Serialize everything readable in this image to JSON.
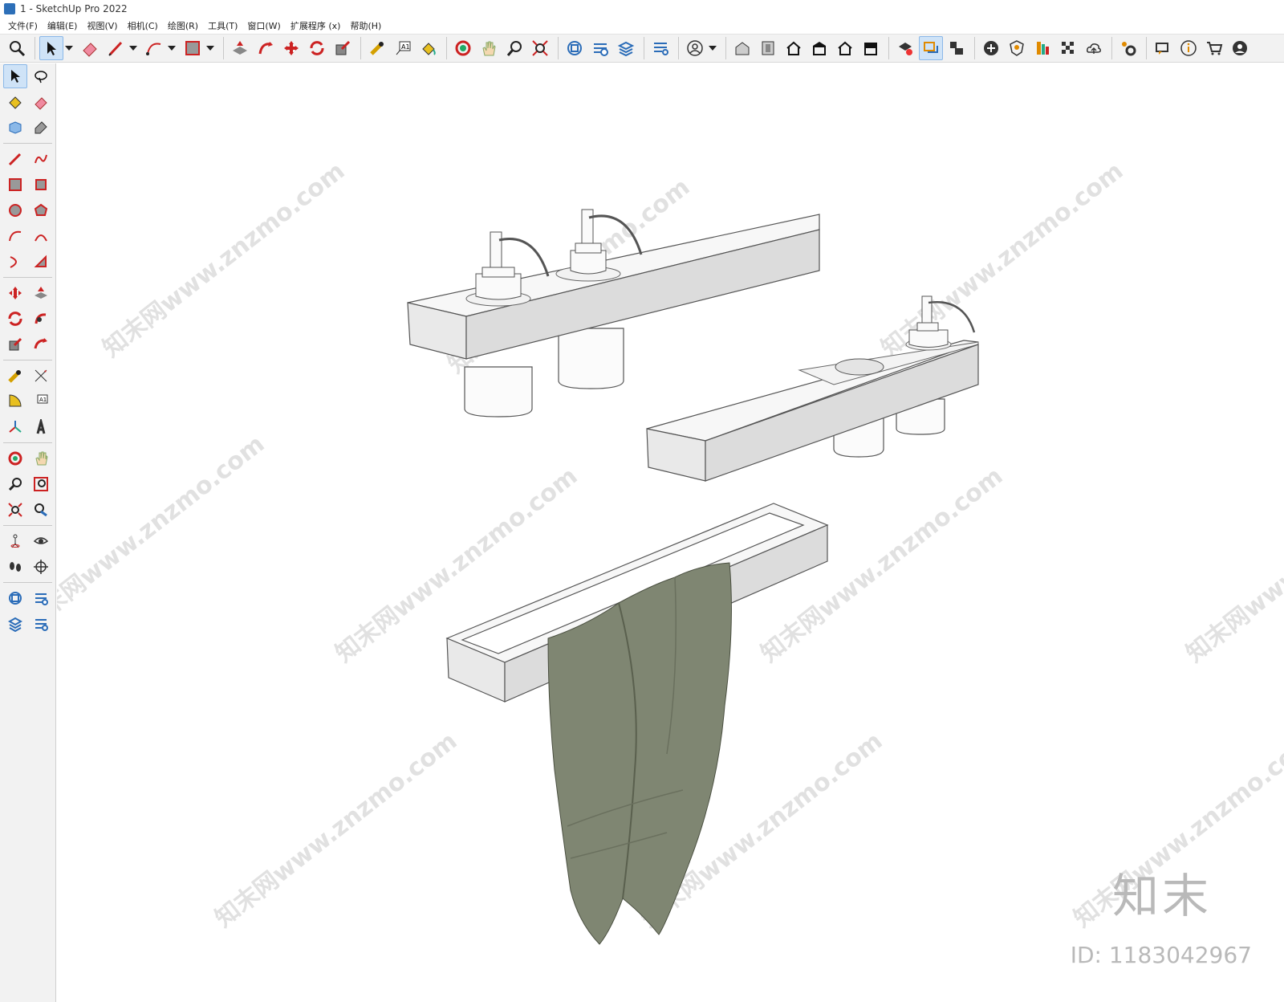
{
  "window": {
    "title": "1 - SketchUp Pro 2022"
  },
  "menu": [
    "文件(F)",
    "编辑(E)",
    "视图(V)",
    "相机(C)",
    "绘图(R)",
    "工具(T)",
    "窗口(W)",
    "扩展程序 (x)",
    "帮助(H)"
  ],
  "toolbar_icons": [
    "zoom-icon",
    "select-icon",
    "eraser-icon",
    "pencil-icon",
    "arc-icon",
    "rectangle-icon",
    "push-pull-icon",
    "follow-me-icon",
    "move-icon",
    "rotate-icon",
    "scale-icon",
    "tape-measure-icon",
    "text-icon",
    "paint-bucket-icon",
    "orbit-icon",
    "pan-icon",
    "zoom-window-icon",
    "zoom-extents-icon",
    "components-icon",
    "styles-icon",
    "layers-icon",
    "scenes-icon",
    "user-icon",
    "warehouse-icon",
    "share-model-icon",
    "home-icon",
    "house-icon",
    "shop-icon",
    "extension-icon",
    "solid-tools-icon",
    "outliner-icon",
    "add-icon",
    "shield-icon",
    "material-icon",
    "checker-icon",
    "cloud-icon",
    "settings-icon",
    "comment-icon",
    "info-icon",
    "cart-icon",
    "account-icon"
  ],
  "viewport": {
    "watermark_text": "知末网www.znzmo.com",
    "brand": "知末",
    "model_id": "ID: 1183042967"
  },
  "colors": {
    "toolbar_bg": "#f2f2f2",
    "active_tool": "#cfe3f7",
    "model_white": "#f4f4f4",
    "towel": "#7f8672"
  }
}
